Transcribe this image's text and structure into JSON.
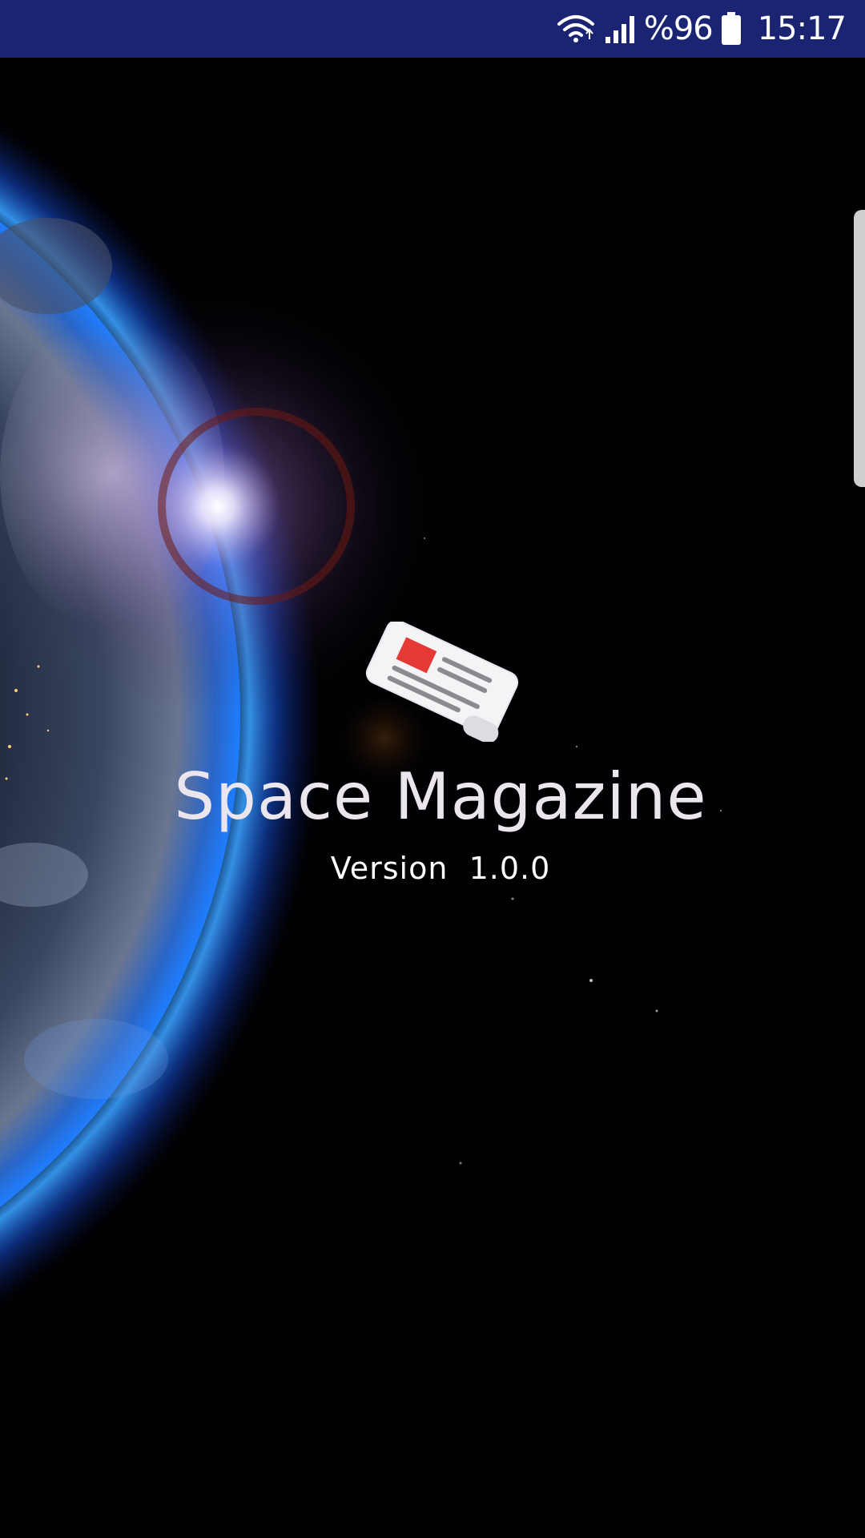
{
  "status_bar": {
    "battery_percent": "%96",
    "time": "15:17",
    "icons": [
      "wifi-icon",
      "signal-icon",
      "battery-icon"
    ],
    "background_color": "#1a2472"
  },
  "splash": {
    "title": "Space Magazine",
    "version_label": "Version",
    "version_number": "1.0.0",
    "logo_icon": "newspaper-icon",
    "accent_color": "#e53935"
  },
  "background": {
    "scene": "earth-from-space",
    "atmosphere_color": "#1e7dff"
  }
}
